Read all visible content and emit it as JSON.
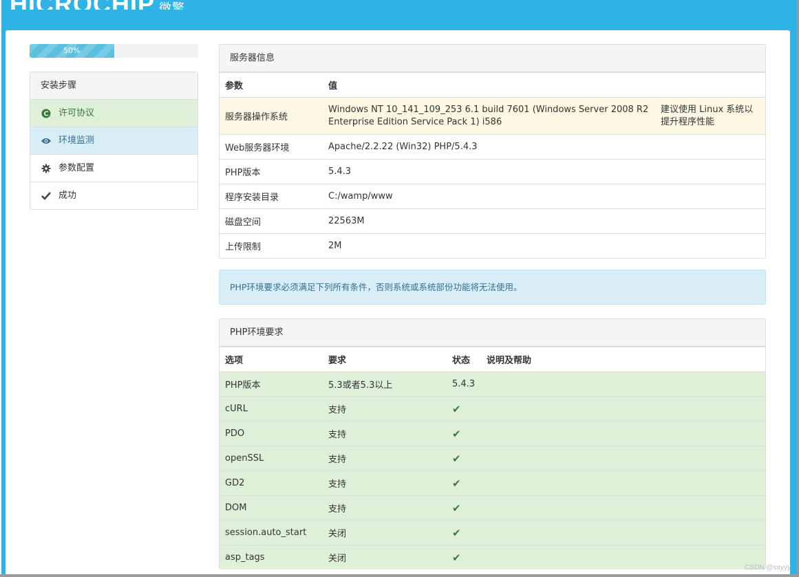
{
  "header": {
    "logo_text": "HICROCHIP",
    "logo_cn": "微擎"
  },
  "progress": {
    "label": "50%",
    "value": 0.5
  },
  "steps": {
    "title": "安装步骤",
    "items": [
      {
        "label": "许可协议",
        "icon": "copyright-icon",
        "state": "done"
      },
      {
        "label": "环境监测",
        "icon": "eye-icon",
        "state": "active"
      },
      {
        "label": "参数配置",
        "icon": "gear-icon",
        "state": ""
      },
      {
        "label": "成功",
        "icon": "check-icon",
        "state": ""
      }
    ]
  },
  "server": {
    "title": "服务器信息",
    "headers": [
      "参数",
      "值"
    ],
    "rows": [
      {
        "param": "服务器操作系统",
        "value": "Windows NT 10_141_109_253 6.1 build 7601 (Windows Server 2008 R2 Enterprise Edition Service Pack 1) i586",
        "note": "建议使用 Linux 系统以提升程序性能"
      },
      {
        "param": "Web服务器环境",
        "value": "Apache/2.2.22 (Win32) PHP/5.4.3",
        "note": ""
      },
      {
        "param": "PHP版本",
        "value": "5.4.3",
        "note": ""
      },
      {
        "param": "程序安装目录",
        "value": "C:/wamp/www",
        "note": ""
      },
      {
        "param": "磁盘空间",
        "value": "22563M",
        "note": ""
      },
      {
        "param": "上传限制",
        "value": "2M",
        "note": ""
      }
    ]
  },
  "alert": {
    "text": "PHP环境要求必须满足下列所有条件，否则系统或系统部份功能将无法使用。"
  },
  "php": {
    "title": "PHP环境要求",
    "headers": [
      "选项",
      "要求",
      "状态",
      "说明及帮助"
    ],
    "rows": [
      {
        "option": "PHP版本",
        "req": "5.3或者5.3以上",
        "status": "5.4.3"
      },
      {
        "option": "cURL",
        "req": "支持",
        "status": "✔"
      },
      {
        "option": "PDO",
        "req": "支持",
        "status": "✔"
      },
      {
        "option": "openSSL",
        "req": "支持",
        "status": "✔"
      },
      {
        "option": "GD2",
        "req": "支持",
        "status": "✔"
      },
      {
        "option": "DOM",
        "req": "支持",
        "status": "✔"
      },
      {
        "option": "session.auto_start",
        "req": "关闭",
        "status": "✔"
      },
      {
        "option": "asp_tags",
        "req": "关闭",
        "status": "✔"
      }
    ]
  },
  "watermark": "CSDN @sayyy",
  "colors": {
    "header_bg": "#2eb3e6",
    "success_bg": "#dff0d8",
    "info_bg": "#d9edf7",
    "warning_bg": "#fcf8e3"
  }
}
